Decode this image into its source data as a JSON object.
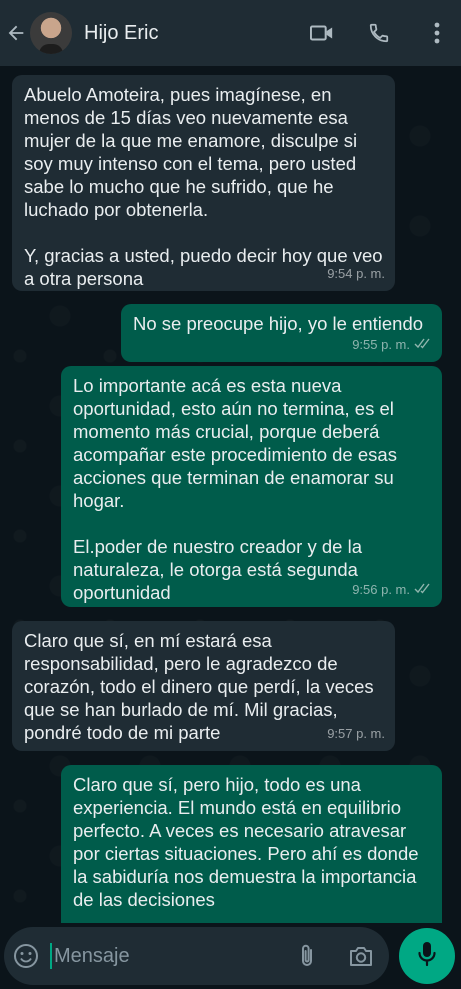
{
  "header": {
    "contact_name": "Hijo Eric",
    "icons": [
      "back-arrow-icon",
      "video-call-icon",
      "voice-call-icon",
      "more-options-icon"
    ]
  },
  "messages": [
    {
      "direction": "incoming",
      "text": "Abuelo Amoteira, pues imagínese, en menos de 15 días veo nuevamente esa mujer de la que me enamore, disculpe si soy muy intenso con el tema, pero usted sabe lo mucho que he sufrido, que he luchado por obtenerla.\n\nY, gracias a usted, puedo decir hoy que veo a otra persona",
      "time": "9:54 p. m."
    },
    {
      "direction": "outgoing",
      "text": "No se preocupe hijo, yo le entiendo",
      "time": "9:55 p. m."
    },
    {
      "direction": "outgoing",
      "text": "Lo importante acá es esta nueva oportunidad, esto aún no termina, es el momento más crucial, porque deberá acompañar este procedimiento de esas acciones que terminan de enamorar su hogar.\n\nEl.poder de nuestro creador y de la naturaleza, le otorga está segunda oportunidad",
      "time": "9:56 p. m."
    },
    {
      "direction": "incoming",
      "text": "Claro que sí, en mí estará esa responsabilidad, pero le agradezco de corazón, todo el dinero que perdí, la veces que se han burlado de mí. Mil gracias, pondré todo de mi parte",
      "time": "9:57 p. m."
    },
    {
      "direction": "outgoing",
      "text": "Claro que sí, pero hijo, todo es una experiencia. El mundo está en equilibrio perfecto. A veces es necesario atravesar por ciertas situaciones. Pero ahí es donde la sabiduría nos demuestra la importancia de las decisiones",
      "time": ""
    }
  ],
  "composer": {
    "placeholder": "Mensaje",
    "icons": [
      "emoji-icon",
      "attach-icon",
      "camera-icon",
      "mic-icon"
    ]
  },
  "colors": {
    "background": "#0b141a",
    "header": "#1f2c34",
    "incoming_bubble": "#1f2c34",
    "outgoing_bubble": "#005c4b",
    "accent": "#00a884"
  }
}
